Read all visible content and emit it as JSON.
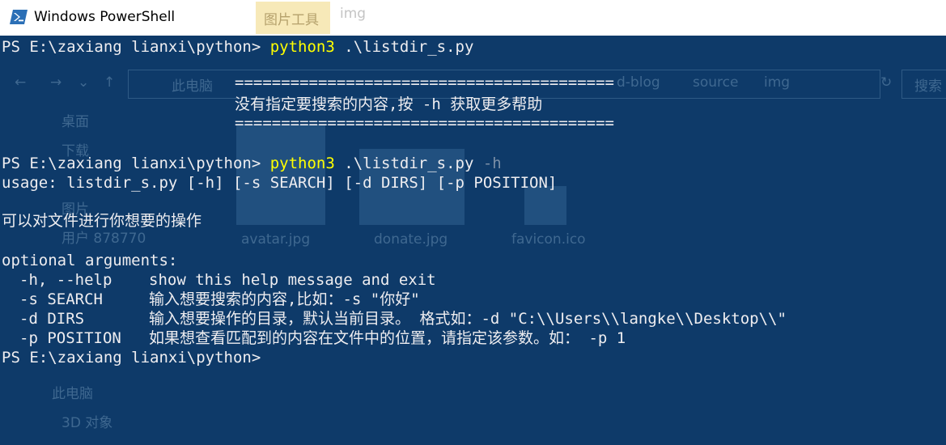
{
  "window": {
    "title": "Windows PowerShell",
    "icon": "powershell-icon"
  },
  "background_window": {
    "ribbon_tab": "图片工具",
    "title": "img",
    "nav_path": [
      "此电脑",
      "source",
      "img"
    ],
    "path_fragment": "d-blog",
    "search_label": "搜索",
    "sidebar": [
      "桌面",
      "下载",
      "图片",
      "用户 878770",
      "此电脑",
      "3D 对象"
    ],
    "files": [
      "avatar.jpg",
      "donate.jpg",
      "favicon.ico"
    ]
  },
  "terminal": {
    "prompt": "PS E:\\zaxiang lianxi\\python> ",
    "commands": [
      {
        "program": "python3",
        "args": " .\\listdir_s.py",
        "flag": ""
      },
      {
        "program": "python3",
        "args": " .\\listdir_s.py",
        "flag": " -h"
      }
    ],
    "banner": {
      "rule": "=========================================",
      "message": "没有指定要搜索的内容,按 -h 获取更多帮助"
    },
    "usage": "usage: listdir_s.py [-h] [-s SEARCH] [-d DIRS] [-p POSITION]",
    "description": "可以对文件进行你想要的操作",
    "optional_header": "optional arguments:",
    "options": [
      {
        "key": "-h, --help",
        "desc": "show this help message and exit"
      },
      {
        "key": "-s SEARCH",
        "desc": "输入想要搜索的内容,比如：-s \"你好\""
      },
      {
        "key": "-d DIRS",
        "desc": "输入想要操作的目录，默认当前目录。 格式如：-d \"C:\\\\Users\\\\langke\\\\Desktop\\\\\""
      },
      {
        "key": "-p POSITION",
        "desc": "如果想查看匹配到的内容在文件中的位置，请指定该参数。如： -p 1"
      }
    ]
  },
  "colors": {
    "console_background": "#0e3a69",
    "console_text": "#eeedf0",
    "command_text": "#ffff00",
    "flag_text": "#7a8ea6"
  }
}
